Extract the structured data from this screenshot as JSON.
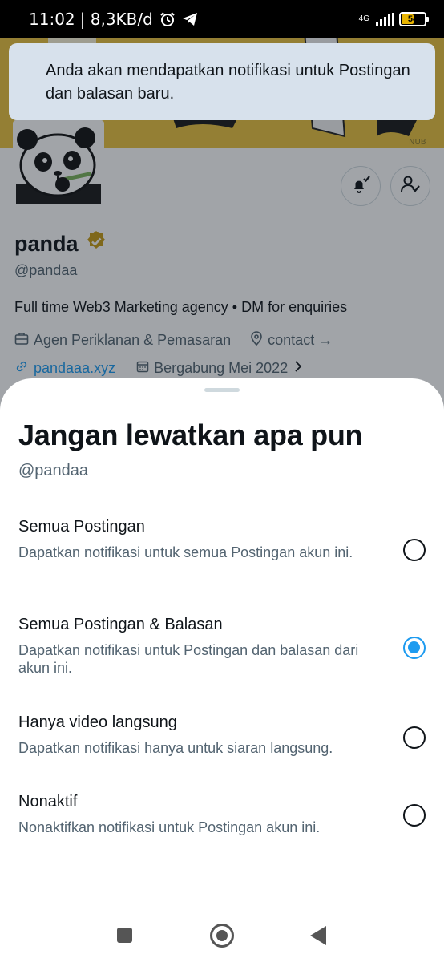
{
  "status_bar": {
    "time": "11:02",
    "speed": "| 8,3KB/d",
    "network_type": "4G",
    "battery_level": "54"
  },
  "toast": {
    "message": "Anda akan mendapatkan notifikasi untuk Postingan dan balasan baru."
  },
  "profile": {
    "display_name": "panda",
    "handle": "@pandaa",
    "bio": "Full time Web3 Marketing agency • DM for enquiries",
    "category": "Agen Periklanan & Pemasaran",
    "location": "contact →",
    "website": "pandaaa.xyz",
    "joined": "Bergabung Mei 2022",
    "banner_signature": "NUB"
  },
  "sheet": {
    "title": "Jangan lewatkan apa pun",
    "handle": "@pandaa",
    "options": [
      {
        "title": "Semua Postingan",
        "description": "Dapatkan notifikasi untuk semua Postingan akun ini.",
        "selected": false
      },
      {
        "title": "Semua Postingan & Balasan",
        "description": "Dapatkan notifikasi untuk Postingan dan balasan dari akun ini.",
        "selected": true
      },
      {
        "title": "Hanya video langsung",
        "description": "Dapatkan notifikasi hanya untuk siaran langsung.",
        "selected": false
      },
      {
        "title": "Nonaktif",
        "description": "Nonaktifkan notifikasi untuk Postingan akun ini.",
        "selected": false
      }
    ]
  },
  "colors": {
    "accent": "#1d9bf0",
    "banner": "#e9c23f",
    "verified_badge": "#c69c15",
    "toast_bg": "#d7e1ec",
    "secondary_text": "#536471"
  },
  "icons": {
    "status": [
      "alarm-icon",
      "telegram-icon",
      "signal-icon",
      "battery-icon"
    ],
    "profile": [
      "bell-check-icon",
      "person-check-icon",
      "verified-badge-icon",
      "briefcase-icon",
      "location-pin-icon",
      "link-icon",
      "calendar-icon",
      "chevron-right-icon"
    ],
    "navigation": [
      "recents-square-icon",
      "home-circle-icon",
      "back-triangle-icon"
    ]
  }
}
